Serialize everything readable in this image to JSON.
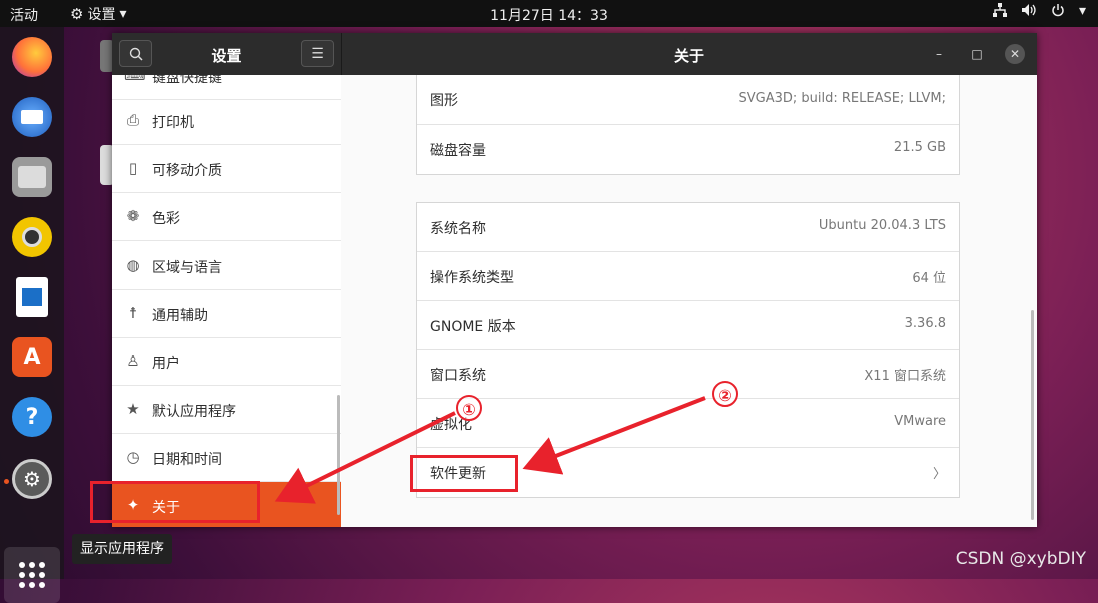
{
  "topbar": {
    "activities": "活动",
    "app_menu": "设置",
    "app_menu_arrow": "▾",
    "clock": "11月27日  14：33",
    "tray_icons": [
      "network-icon",
      "volume-icon",
      "power-icon",
      "chevron-down-icon"
    ]
  },
  "dock": {
    "apps": [
      "firefox",
      "thunderbird",
      "files",
      "rhythmbox",
      "libreoffice-writer",
      "ubuntu-software",
      "help",
      "settings"
    ],
    "tooltip": "显示应用程序"
  },
  "window": {
    "sidebar_title": "设置",
    "main_title": "关于",
    "sidebar_items": [
      {
        "label": "键盘快捷键",
        "icon": "keyboard-icon"
      },
      {
        "label": "打印机",
        "icon": "printer-icon"
      },
      {
        "label": "可移动介质",
        "icon": "removable-media-icon"
      },
      {
        "label": "色彩",
        "icon": "color-icon"
      },
      {
        "label": "区域与语言",
        "icon": "globe-icon"
      },
      {
        "label": "通用辅助",
        "icon": "accessibility-icon"
      },
      {
        "label": "用户",
        "icon": "users-icon"
      },
      {
        "label": "默认应用程序",
        "icon": "star-icon"
      },
      {
        "label": "日期和时间",
        "icon": "clock-icon"
      },
      {
        "label": "关于",
        "icon": "sparkle-icon",
        "active": true
      }
    ],
    "hardware_card": [
      {
        "key": "图形",
        "value": "SVGA3D; build: RELEASE; LLVM;"
      },
      {
        "key": "磁盘容量",
        "value": "21.5 GB"
      }
    ],
    "system_card": [
      {
        "key": "系统名称",
        "value": "Ubuntu 20.04.3 LTS"
      },
      {
        "key": "操作系统类型",
        "value": "64 位"
      },
      {
        "key": "GNOME 版本",
        "value": "3.36.8"
      },
      {
        "key": "窗口系统",
        "value": "X11 窗口系统"
      },
      {
        "key": "虚拟化",
        "value": "VMware"
      },
      {
        "key": "软件更新",
        "value": "〉"
      }
    ]
  },
  "annotations": {
    "marker1": "①",
    "marker2": "②",
    "color": "#e8222c"
  },
  "watermark": "CSDN @xybDIY",
  "colors": {
    "accent": "#e95420",
    "titlebar": "#2c2c2c"
  }
}
